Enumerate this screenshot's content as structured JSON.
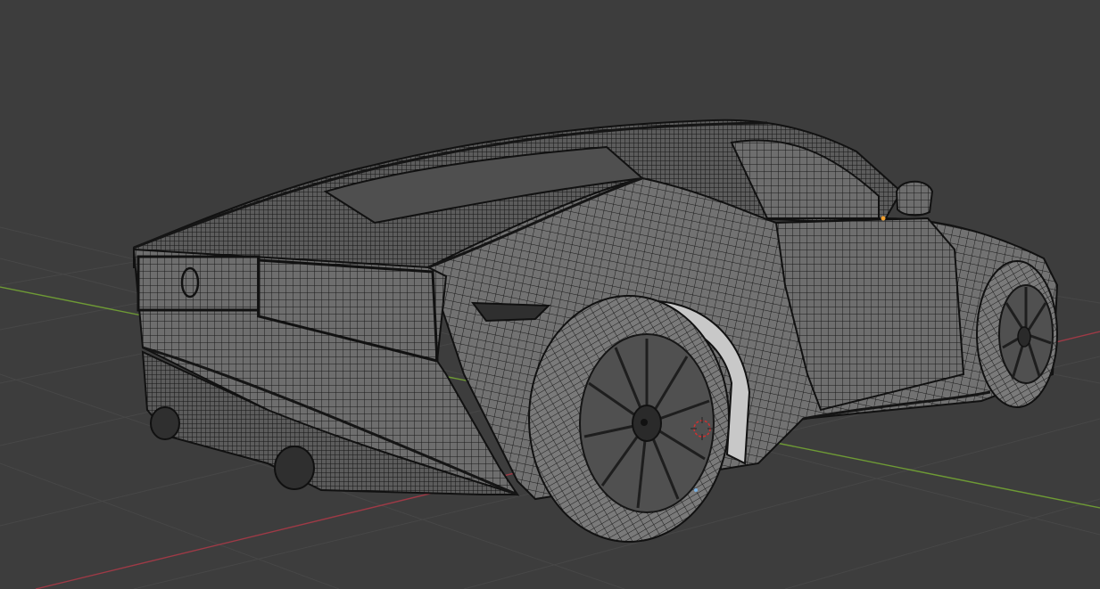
{
  "viewport": {
    "background_color": "#3d3d3d",
    "grid_color": "#474747",
    "x_axis_color": "#9e3a46",
    "y_axis_color": "#6e9a35"
  },
  "scene": {
    "object": "car-mesh-wireframe",
    "mesh_color": "#5a5a5a",
    "wire_color": "#151515",
    "selected_vertex_color": "#f0a030",
    "cursor_color": "#d03030",
    "icons": [
      "3d-cursor-icon",
      "emblem-icon"
    ]
  }
}
